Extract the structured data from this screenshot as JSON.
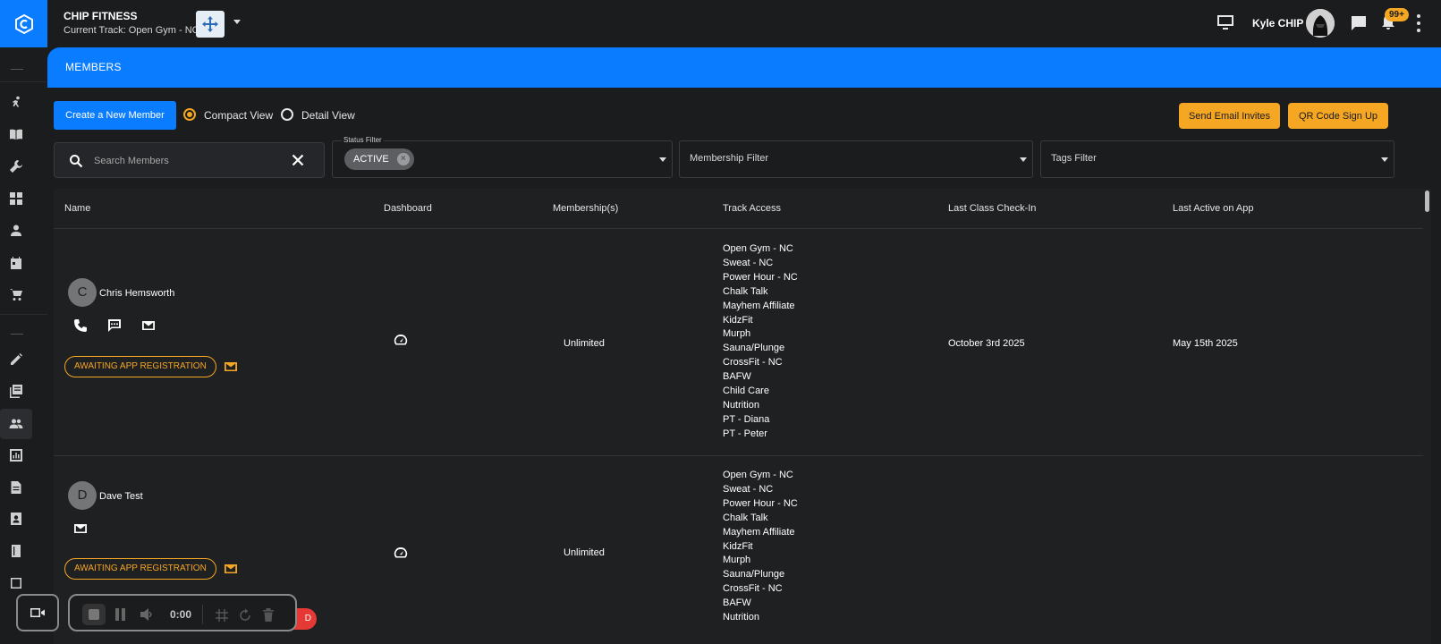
{
  "app": {
    "org_name": "CHIP FITNESS",
    "current_track": "Current Track: Open Gym - NC",
    "user_name": "Kyle CHIP",
    "notifications_count": "99+",
    "page_title": "MEMBERS"
  },
  "actions": {
    "create_member": "Create a New Member",
    "compact_view": "Compact View",
    "detail_view": "Detail View",
    "view_mode": "compact",
    "send_email_invites": "Send Email Invites",
    "qr_code_sign_up": "QR Code Sign Up"
  },
  "filters": {
    "search_placeholder": "Search Members",
    "status_filter_label": "Status Filter",
    "status_chip": "ACTIVE",
    "membership_filter": "Membership Filter",
    "tags_filter": "Tags Filter"
  },
  "table": {
    "columns": [
      "Name",
      "Dashboard",
      "Membership(s)",
      "Track Access",
      "Last Class Check-In",
      "Last Active on App"
    ],
    "rows": [
      {
        "initial": "C",
        "name": "Chris Hemsworth",
        "status": "AWAITING APP REGISTRATION",
        "membership": "Unlimited",
        "tracks": [
          "Open Gym - NC",
          "Sweat - NC",
          "Power Hour - NC",
          "Chalk Talk",
          "Mayhem Affiliate",
          "KidzFit",
          "Murph",
          "Sauna/Plunge",
          "CrossFit - NC",
          "BAFW",
          "Child Care",
          "Nutrition",
          "PT - Diana",
          "PT - Peter"
        ],
        "last_check_in": "October 3rd 2025",
        "last_active": "May 15th 2025"
      },
      {
        "initial": "D",
        "name": "Dave Test",
        "status": "AWAITING APP REGISTRATION",
        "membership": "Unlimited",
        "tracks": [
          "Open Gym - NC",
          "Sweat - NC",
          "Power Hour - NC",
          "Chalk Talk",
          "Mayhem Affiliate",
          "KidzFit",
          "Murph",
          "Sauna/Plunge",
          "CrossFit - NC",
          "BAFW",
          "Nutrition"
        ],
        "last_check_in": "",
        "last_active": ""
      }
    ]
  },
  "recorder": {
    "time": "0:00",
    "red_label": "D"
  },
  "colors": {
    "accent_blue": "#0a7cff",
    "accent_orange": "#f5a623",
    "background": "#1b1c1e"
  }
}
